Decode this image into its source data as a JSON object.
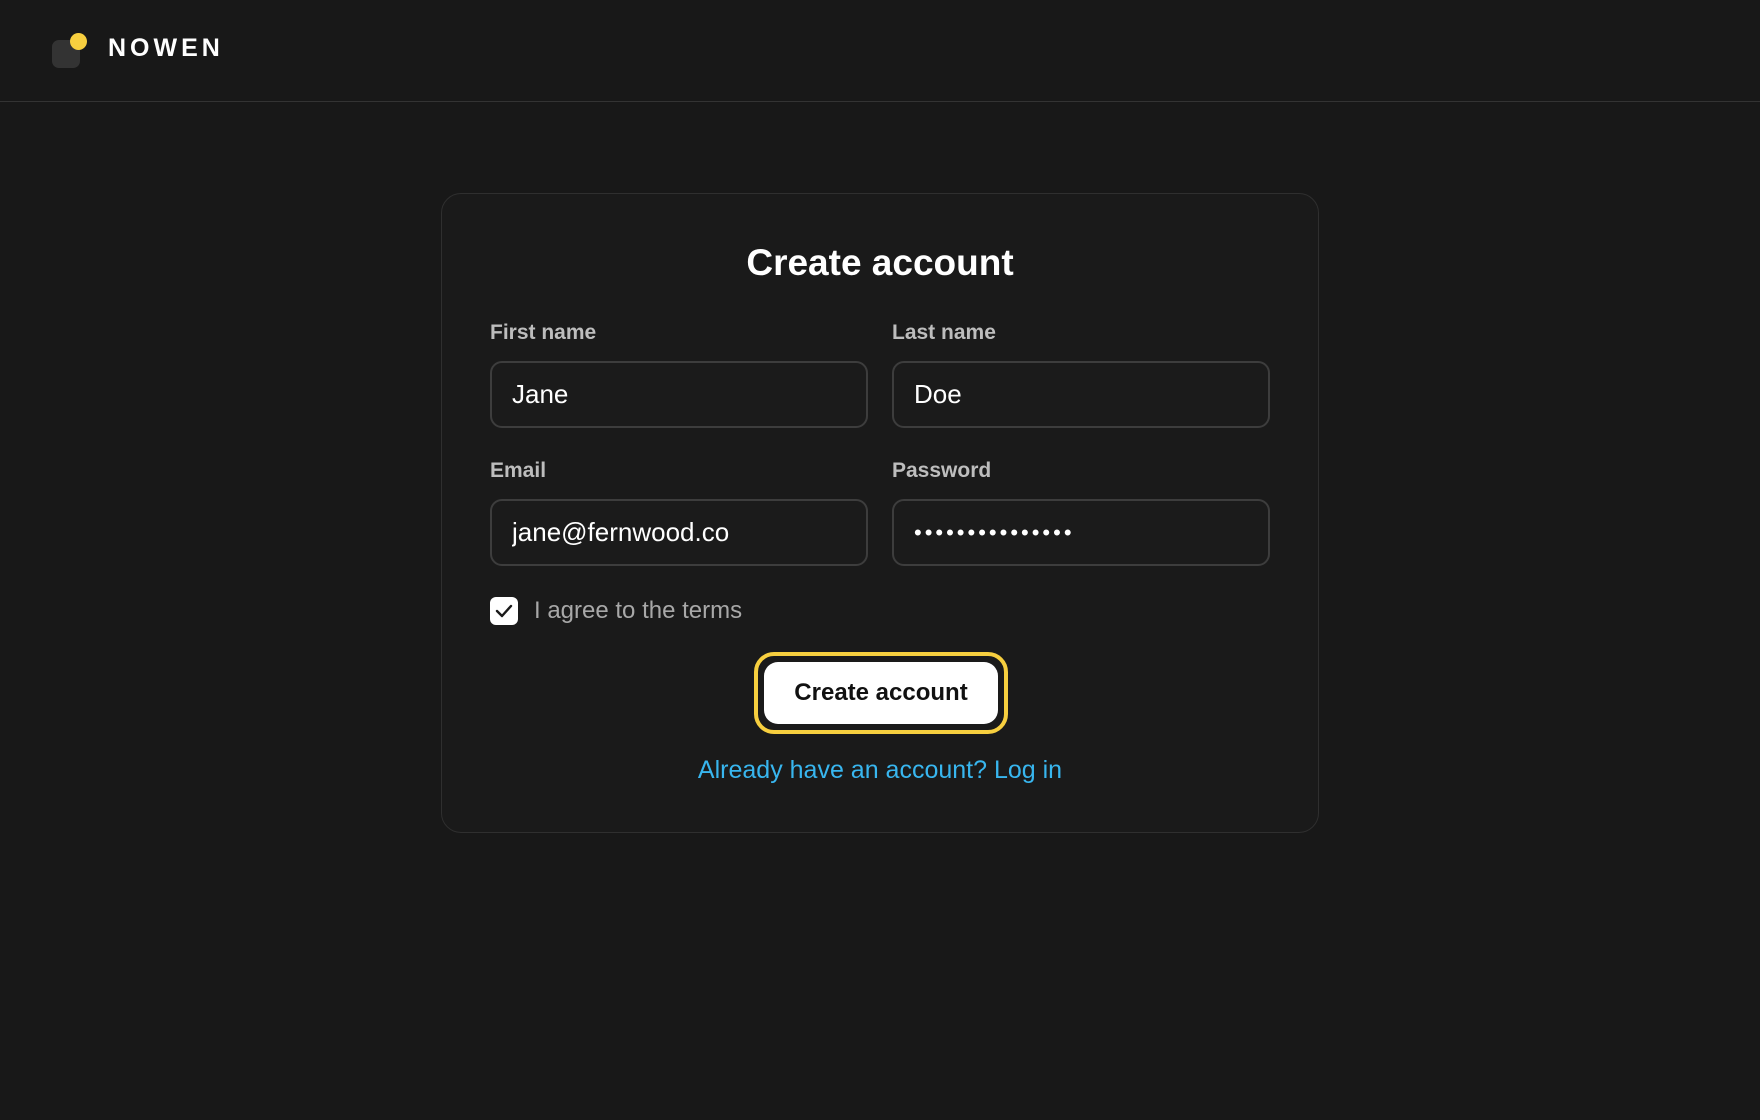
{
  "brand": {
    "name": "NOWEN",
    "accent_color": "#f7cf3f"
  },
  "form": {
    "title": "Create account",
    "fields": {
      "first_name": {
        "label": "First name",
        "value": "Jane"
      },
      "last_name": {
        "label": "Last name",
        "value": "Doe"
      },
      "email": {
        "label": "Email",
        "value": "jane@fernwood.co"
      },
      "password": {
        "label": "Password",
        "value": "•••••••••••••••"
      }
    },
    "terms": {
      "label": "I agree to the terms",
      "checked": true
    },
    "submit_label": "Create account",
    "login_link": "Already have an account? Log in",
    "link_color": "#38b6ef"
  }
}
